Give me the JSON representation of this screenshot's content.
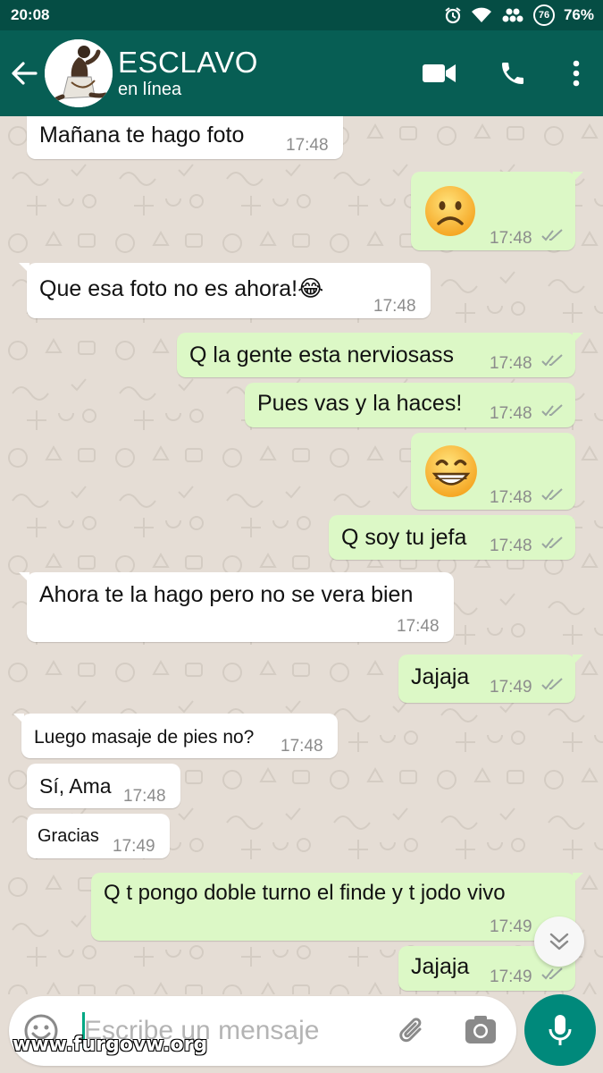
{
  "status_bar": {
    "time": "20:08",
    "battery_ring": "76",
    "battery_percent": "76%"
  },
  "header": {
    "contact_name": "ESCLAVO",
    "contact_status": "en línea"
  },
  "messages": [
    {
      "dir": "in",
      "text": "Mañana te hago foto",
      "time": "17:48"
    },
    {
      "dir": "out",
      "emoji": "slightly-frowning-face",
      "time": "17:48"
    },
    {
      "dir": "in",
      "text": "Que esa foto no es ahora!😂",
      "time": "17:48"
    },
    {
      "dir": "out",
      "text": "Q la gente esta nerviosass",
      "time": "17:48"
    },
    {
      "dir": "out",
      "text": "Pues vas y la haces!",
      "time": "17:48"
    },
    {
      "dir": "out",
      "emoji": "grinning-face",
      "time": "17:48"
    },
    {
      "dir": "out",
      "text": "Q soy tu jefa",
      "time": "17:48"
    },
    {
      "dir": "in",
      "text": "Ahora te la hago pero no se vera bien",
      "time": "17:48"
    },
    {
      "dir": "out",
      "text": "Jajaja",
      "time": "17:49"
    },
    {
      "dir": "in",
      "text": "Luego masaje de pies no?",
      "time": "17:48"
    },
    {
      "dir": "in",
      "text": "Sí, Ama",
      "time": "17:48"
    },
    {
      "dir": "in",
      "text": "Gracias",
      "time": "17:49"
    },
    {
      "dir": "out",
      "text": "Q t pongo doble turno el finde y t jodo vivo",
      "time": "17:49"
    },
    {
      "dir": "out",
      "text": "Jajaja",
      "time": "17:49"
    }
  ],
  "composer": {
    "placeholder": "Escribe un mensaje"
  },
  "watermark": "www.furgovw.org",
  "colors": {
    "header": "#075e54",
    "status_bar": "#054d44",
    "outgoing_bubble": "#dcf8c6",
    "incoming_bubble": "#ffffff",
    "chat_background": "#e5ddd5",
    "accent": "#00897b",
    "read_ticks": "#9aa5a0"
  }
}
